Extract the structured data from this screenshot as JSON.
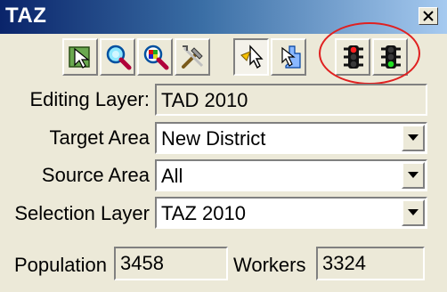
{
  "window": {
    "title": "TAZ"
  },
  "toolbar": {
    "buttons": [
      {
        "name": "select-tool",
        "icon": "select-arrow-icon"
      },
      {
        "name": "zoom-in",
        "icon": "magnifier-cyan-icon"
      },
      {
        "name": "zoom-extent",
        "icon": "magnifier-map-icon"
      },
      {
        "name": "tools",
        "icon": "tools-icon"
      },
      {
        "name": "pointer-select",
        "icon": "pointer-cursor-icon",
        "pressed": true
      },
      {
        "name": "pointer-add",
        "icon": "pointer-blue-icon"
      },
      {
        "name": "traffic-light-red",
        "icon": "traffic-light-red-icon"
      },
      {
        "name": "traffic-light-green",
        "icon": "traffic-light-green-icon"
      }
    ]
  },
  "form": {
    "editing_layer": {
      "label": "Editing Layer:",
      "value": "TAD 2010"
    },
    "target_area": {
      "label": "Target Area",
      "value": "New District"
    },
    "source_area": {
      "label": "Source Area",
      "value": "All"
    },
    "selection_layer": {
      "label": "Selection Layer",
      "value": "TAZ 2010"
    },
    "population": {
      "label": "Population",
      "value": "3458"
    },
    "workers": {
      "label": "Workers",
      "value": "3324"
    }
  },
  "colors": {
    "title_bar_start": "#0a246a",
    "title_bar_end": "#a6caf0",
    "highlight": "#e02020",
    "face": "#ece9d8"
  }
}
